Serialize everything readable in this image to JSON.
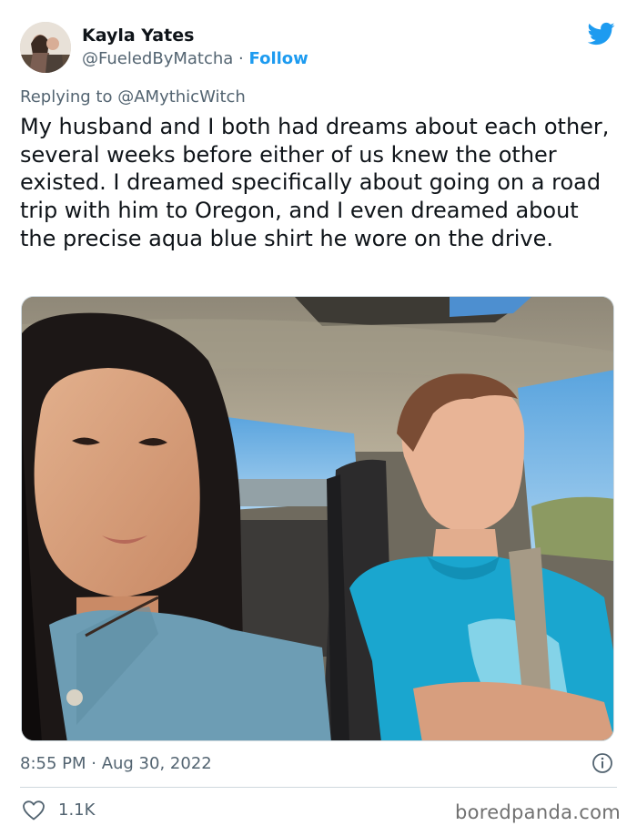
{
  "tweet": {
    "author": {
      "name": "Kayla Yates",
      "handle": "@FueledByMatcha",
      "separator": "·",
      "follow_label": "Follow"
    },
    "replying_prefix": "Replying to",
    "replying_to": "@AMythicWitch",
    "text": "My husband and I both had dreams about each other, several weeks before either of us knew the other existed. I dreamed specifically about going on a road trip with him to Oregon, and I even dreamed about the precise aqua blue shirt he wore on the drive.",
    "timestamp": "8:55 PM · Aug 30, 2022",
    "likes": "1.1K"
  },
  "icons": {
    "brand": "twitter-bird-icon",
    "info": "info-icon",
    "like": "heart-icon"
  },
  "watermark": "boredpanda.com",
  "colors": {
    "twitter_blue": "#1d9bf0",
    "secondary_text": "#536471",
    "primary_text": "#0f1419",
    "divider": "#cfd9de"
  }
}
